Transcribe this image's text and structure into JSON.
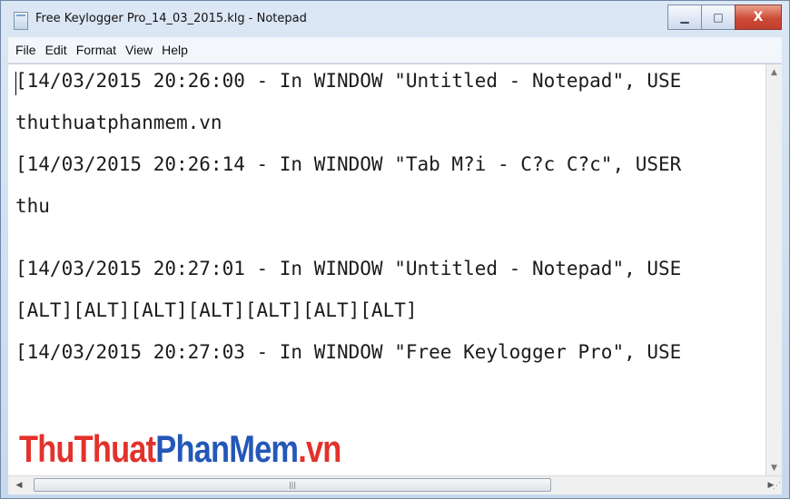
{
  "window": {
    "title": "Free Keylogger Pro_14_03_2015.klg - Notepad",
    "buttons": {
      "minimize": "▁",
      "maximize": "□",
      "close": "X"
    }
  },
  "menu": {
    "items": [
      "File",
      "Edit",
      "Format",
      "View",
      "Help"
    ]
  },
  "document": {
    "lines": [
      "[14/03/2015 20:26:00 - In WINDOW \"Untitled - Notepad\", USE",
      "thuthuatphanmem.vn",
      "[14/03/2015 20:26:14 - In WINDOW \"Tab M?i - C?c C?c\", USER",
      "thu",
      "",
      "[14/03/2015 20:27:01 - In WINDOW \"Untitled - Notepad\", USE",
      "[ALT][ALT][ALT][ALT][ALT][ALT][ALT]",
      "[14/03/2015 20:27:03 - In WINDOW \"Free Keylogger Pro\", USE"
    ]
  },
  "watermark": {
    "part1": "ThuThuat",
    "part2": "PhanMem",
    "part3": ".vn",
    "colors": {
      "red": "#e2322b",
      "blue": "#2457b7"
    }
  },
  "icons": {
    "app": "notepad-icon",
    "scroll_up": "▲",
    "scroll_down": "▼",
    "scroll_left": "◀",
    "scroll_right": "▶",
    "thumb_grip": "|||",
    "resize": "⋰"
  }
}
